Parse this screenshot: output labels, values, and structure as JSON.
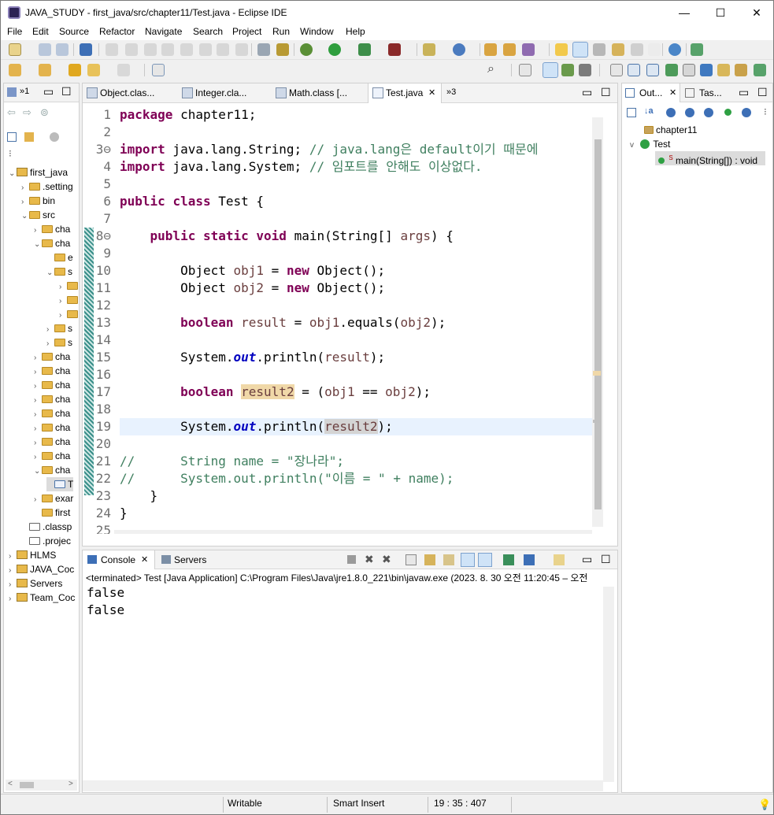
{
  "window": {
    "title": "JAVA_STUDY - first_java/src/chapter11/Test.java - Eclipse IDE",
    "minimize": "—",
    "maximize": "☐",
    "close": "✕"
  },
  "menu": [
    "File",
    "Edit",
    "Source",
    "Refactor",
    "Navigate",
    "Search",
    "Project",
    "Run",
    "Window",
    "Help"
  ],
  "package_explorer": {
    "tab_overflow": "»1",
    "rows": [
      {
        "label": "first_java",
        "kind": "project",
        "indent": 0,
        "twisty": "v"
      },
      {
        "label": ".setting",
        "kind": "folder",
        "indent": 1,
        "twisty": ">"
      },
      {
        "label": "bin",
        "kind": "folder",
        "indent": 1,
        "twisty": ">"
      },
      {
        "label": "src",
        "kind": "folder",
        "indent": 1,
        "twisty": "v"
      },
      {
        "label": "cha",
        "kind": "folder",
        "indent": 2,
        "twisty": ">"
      },
      {
        "label": "cha",
        "kind": "folder",
        "indent": 2,
        "twisty": "v"
      },
      {
        "label": "e",
        "kind": "folder",
        "indent": 3,
        "twisty": ""
      },
      {
        "label": "s",
        "kind": "folder",
        "indent": 3,
        "twisty": "v"
      },
      {
        "label": "",
        "kind": "folder",
        "indent": 4,
        "twisty": ">"
      },
      {
        "label": "",
        "kind": "folder",
        "indent": 4,
        "twisty": ">"
      },
      {
        "label": "",
        "kind": "folder",
        "indent": 4,
        "twisty": ">"
      },
      {
        "label": "s",
        "kind": "folder",
        "indent": 3,
        "twisty": ">"
      },
      {
        "label": "s",
        "kind": "folder",
        "indent": 3,
        "twisty": ">"
      },
      {
        "label": "cha",
        "kind": "folder",
        "indent": 2,
        "twisty": ">"
      },
      {
        "label": "cha",
        "kind": "folder",
        "indent": 2,
        "twisty": ">"
      },
      {
        "label": "cha",
        "kind": "folder",
        "indent": 2,
        "twisty": ">"
      },
      {
        "label": "cha",
        "kind": "folder",
        "indent": 2,
        "twisty": ">"
      },
      {
        "label": "cha",
        "kind": "folder",
        "indent": 2,
        "twisty": ">"
      },
      {
        "label": "cha",
        "kind": "folder",
        "indent": 2,
        "twisty": ">"
      },
      {
        "label": "cha",
        "kind": "folder",
        "indent": 2,
        "twisty": ">"
      },
      {
        "label": "cha",
        "kind": "folder",
        "indent": 2,
        "twisty": ">"
      },
      {
        "label": "cha",
        "kind": "folder",
        "indent": 2,
        "twisty": "v"
      },
      {
        "label": "T",
        "kind": "java",
        "indent": 3,
        "twisty": ""
      },
      {
        "label": "exar",
        "kind": "folder",
        "indent": 2,
        "twisty": ">"
      },
      {
        "label": "first",
        "kind": "folder",
        "indent": 2,
        "twisty": ""
      },
      {
        "label": ".classp",
        "kind": "file",
        "indent": 1,
        "twisty": ""
      },
      {
        "label": ".projec",
        "kind": "file",
        "indent": 1,
        "twisty": ""
      },
      {
        "label": "HLMS",
        "kind": "project",
        "indent": 0,
        "twisty": ">"
      },
      {
        "label": "JAVA_Coc",
        "kind": "project",
        "indent": 0,
        "twisty": ">"
      },
      {
        "label": "Servers",
        "kind": "project",
        "indent": 0,
        "twisty": ">"
      },
      {
        "label": "Team_Coc",
        "kind": "project",
        "indent": 0,
        "twisty": ">"
      }
    ]
  },
  "editor": {
    "tabs": [
      {
        "label": "Object.clas...",
        "active": false
      },
      {
        "label": "Integer.cla...",
        "active": false
      },
      {
        "label": "Math.class [...",
        "active": false
      },
      {
        "label": "Test.java",
        "active": true
      }
    ],
    "tab_overflow": "»3",
    "lines": [
      {
        "n": "1",
        "html": "<span class=\"kw\">package</span> chapter11;"
      },
      {
        "n": "2",
        "html": ""
      },
      {
        "n": "3⊖",
        "html": "<span class=\"kw\">import</span> java.lang.String; <span class=\"cm\">// java.lang은 default이기 때문에</span>"
      },
      {
        "n": "4",
        "html": "<span class=\"kw\">import</span> java.lang.System; <span class=\"cm\">// 임포트를 안해도 이상없다.</span>"
      },
      {
        "n": "5",
        "html": ""
      },
      {
        "n": "6",
        "html": "<span class=\"kw\">public</span> <span class=\"kw\">class</span> Test {"
      },
      {
        "n": "7",
        "html": ""
      },
      {
        "n": "8⊖",
        "html": "    <span class=\"kw\">public</span> <span class=\"kw\">static</span> <span class=\"kw\">void</span> main(String[] <span class=\"var\">args</span>) {"
      },
      {
        "n": "9",
        "html": ""
      },
      {
        "n": "10",
        "html": "        Object <span class=\"var\">obj1</span> = <span class=\"kw\">new</span> Object();"
      },
      {
        "n": "11",
        "html": "        Object <span class=\"var\">obj2</span> = <span class=\"kw\">new</span> Object();"
      },
      {
        "n": "12",
        "html": ""
      },
      {
        "n": "13",
        "html": "        <span class=\"kw\">boolean</span> <span class=\"var\">result</span> = <span class=\"var\">obj1</span>.equals(<span class=\"var\">obj2</span>);"
      },
      {
        "n": "14",
        "html": ""
      },
      {
        "n": "15",
        "html": "        System.<span class=\"fld\">out</span>.println(<span class=\"var\">result</span>);"
      },
      {
        "n": "16",
        "html": ""
      },
      {
        "n": "17",
        "html": "        <span class=\"kw\">boolean</span> <span class=\"var hl-occ\">result2</span> = (<span class=\"var\">obj1</span> == <span class=\"var\">obj2</span>);"
      },
      {
        "n": "18",
        "html": ""
      },
      {
        "n": "19",
        "html": "        System.<span class=\"fld\">out</span>.println(<span class=\"var hl-sel\">result2</span>);"
      },
      {
        "n": "20",
        "html": ""
      },
      {
        "n": "21",
        "html": "<span class=\"cm\">//      String name = \"장나라\";</span>"
      },
      {
        "n": "22",
        "html": "<span class=\"cm\">//      System.out.println(\"이름 = \" + name);</span>"
      },
      {
        "n": "23",
        "html": "    }"
      },
      {
        "n": "24",
        "html": "}"
      },
      {
        "n": "25",
        "html": ""
      }
    ]
  },
  "console": {
    "tabs": [
      "Console",
      "Servers"
    ],
    "status": "<terminated> Test [Java Application] C:\\Program Files\\Java\\jre1.8.0_221\\bin\\javaw.exe  (2023. 8. 30 오전 11:20:45 – 오전",
    "output": [
      "false",
      "false"
    ]
  },
  "outline": {
    "tabs": [
      "Out...",
      "Tas..."
    ],
    "items": [
      {
        "label": "chapter11",
        "kind": "package"
      },
      {
        "label": "Test",
        "kind": "class"
      },
      {
        "label": "main(String[]) : void",
        "kind": "method"
      }
    ]
  },
  "status_bar": {
    "mode": "Writable",
    "insert": "Smart Insert",
    "position": "19 : 35 : 407"
  }
}
